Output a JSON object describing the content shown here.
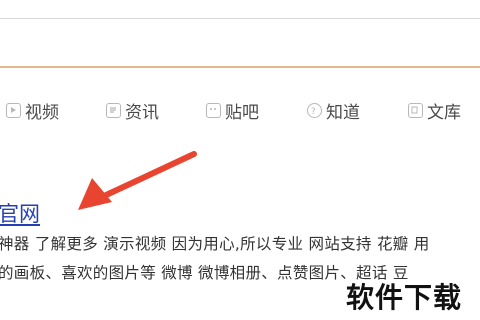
{
  "search": {
    "value": ""
  },
  "nav": {
    "items": [
      {
        "label": "视频",
        "icon": "video-icon"
      },
      {
        "label": "资讯",
        "icon": "news-icon"
      },
      {
        "label": "贴吧",
        "icon": "tieba-icon"
      },
      {
        "label": "知道",
        "icon": "question-icon"
      },
      {
        "label": "文库",
        "icon": "document-icon"
      }
    ]
  },
  "result": {
    "title": "官网",
    "line1": "神器 了解更多 演示视频 因为用心,所以专业 网站支持 花瓣 用",
    "line2": "的画板、喜欢的图片等 微博 微博相册、点赞图片、超话 豆"
  },
  "annotation": {
    "arrow_color": "#e8442f"
  },
  "watermark": {
    "text": "软件下载"
  }
}
